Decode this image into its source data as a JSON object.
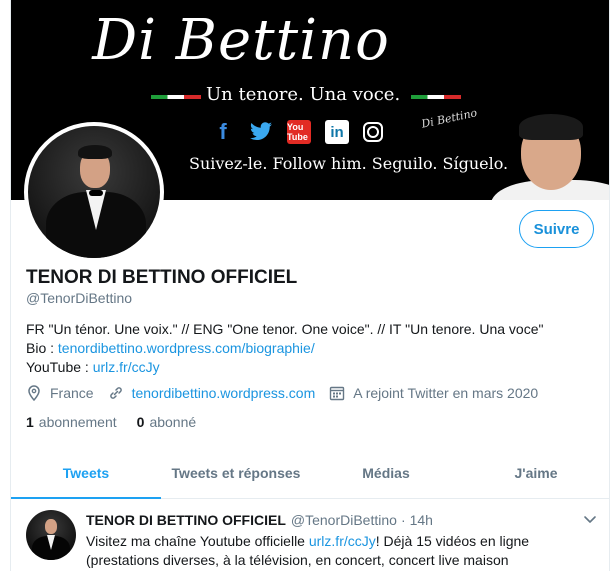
{
  "banner": {
    "title": "Di Bettino",
    "subtitle": "Un tenore. Una voce.",
    "tagline": "Suivez-le. Follow him. Seguilo. Síguelo.",
    "signature": "Di Bettino",
    "social_icons": [
      "facebook-icon",
      "twitter-icon",
      "youtube-icon",
      "linkedin-icon",
      "instagram-icon"
    ],
    "youtube_label": "You Tube",
    "linkedin_label": "in",
    "facebook_label": "f"
  },
  "profile": {
    "display_name": "TENOR DI BETTINO OFFICIEL",
    "handle": "@TenorDiBettino",
    "follow_label": "Suivre",
    "bio_line1": "FR \"Un ténor. Une voix.\" // ENG \"One tenor. One voice\". // IT \"Un tenore. Una voce\"",
    "bio_prefix2": "Bio : ",
    "bio_link2": "tenordibettino.wordpress.com/biographie/",
    "bio_prefix3": "YouTube : ",
    "bio_link3": "urlz.fr/ccJy",
    "location": "France",
    "website": "tenordibettino.wordpress.com",
    "joined": "A rejoint Twitter en mars 2020",
    "following_count": "1",
    "following_label": "abonnement",
    "followers_count": "0",
    "followers_label": "abonné"
  },
  "tabs": [
    {
      "label": "Tweets",
      "active": true
    },
    {
      "label": "Tweets et réponses",
      "active": false
    },
    {
      "label": "Médias",
      "active": false
    },
    {
      "label": "J'aime",
      "active": false
    }
  ],
  "tweet": {
    "name": "TENOR DI BETTINO OFFICIEL",
    "handle": "@TenorDiBettino",
    "separator": "·",
    "time": "14h",
    "text_before": "Visitez ma chaîne Youtube officielle ",
    "link": "urlz.fr/ccJy",
    "text_after": "! Déjà 15 vidéos en ligne (prestations diverses, à la télévision, en concert, concert live maison"
  },
  "colors": {
    "accent": "#1da1f2",
    "link": "#1b95e0",
    "secondary_text": "#657786",
    "border": "#e6ecf0"
  }
}
